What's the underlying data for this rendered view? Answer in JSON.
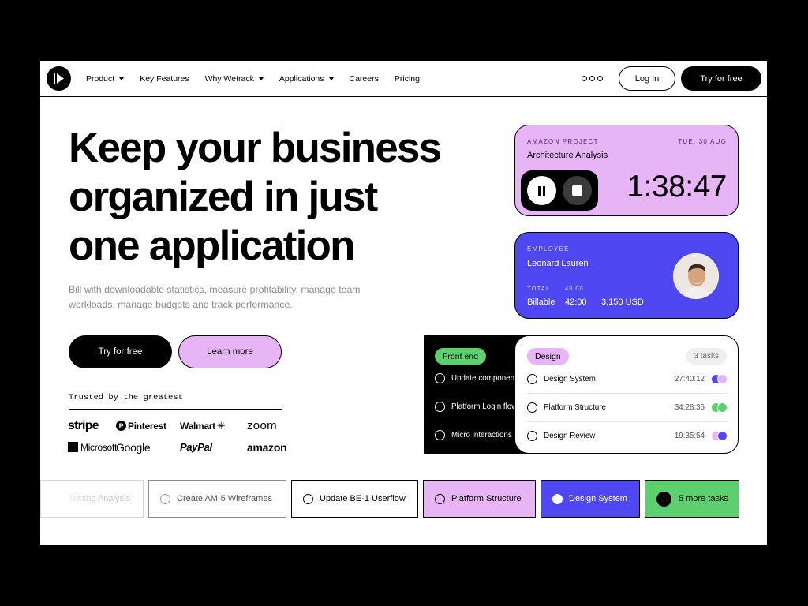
{
  "nav": {
    "items": [
      {
        "label": "Product",
        "dropdown": true
      },
      {
        "label": "Key Features",
        "dropdown": false
      },
      {
        "label": "Why Wetrack",
        "dropdown": true
      },
      {
        "label": "Applications",
        "dropdown": true
      },
      {
        "label": "Careers",
        "dropdown": false
      },
      {
        "label": "Pricing",
        "dropdown": false
      }
    ],
    "login_label": "Log In",
    "try_label": "Try for free"
  },
  "hero": {
    "title_lines": [
      "Keep your business",
      "organized in just",
      "one application"
    ],
    "subtitle": "Bill with downloadable statistics, measure profitability, manage team workloads, manage budgets and track performance.",
    "try_label": "Try for free",
    "learn_label": "Learn more"
  },
  "trusted": {
    "label": "Trusted by the greatest",
    "brands": [
      "stripe",
      "Pinterest",
      "Walmart",
      "zoom",
      "Microsoft",
      "Google",
      "PayPal",
      "amazon"
    ]
  },
  "timer_card": {
    "project": "AMAZON PROJECT",
    "date": "TUE, 30 AUG",
    "task": "Architecture Analysis",
    "time": "1:38:47"
  },
  "employee_card": {
    "label": "EMPLOYEE",
    "name": "Leonard Lauren",
    "total_label": "TOTAL",
    "total_hours": "48:00",
    "billable_label": "Billable",
    "billable_hours": "42:00",
    "amount": "3,150 USD"
  },
  "frontend_panel": {
    "label": "Front end",
    "tasks": [
      "Update components",
      "Platform Login flow",
      "Micro interactions"
    ]
  },
  "design_panel": {
    "label": "Design",
    "count": "3 tasks",
    "tasks": [
      {
        "name": "Design System",
        "time": "27:40:12"
      },
      {
        "name": "Platform Structure",
        "time": "34:28:35"
      },
      {
        "name": "Design Review",
        "time": "19:35:54"
      }
    ]
  },
  "strip": {
    "items": [
      "Testing Analysis",
      "Create AM-5 Wireframes",
      "Update BE-1 Userflow",
      "Platform Structure",
      "Design System"
    ],
    "more_label": "5 more tasks"
  },
  "colors": {
    "purple": "#e7b5f5",
    "blue": "#4f47f2",
    "green": "#5cd06f",
    "black": "#000000"
  }
}
